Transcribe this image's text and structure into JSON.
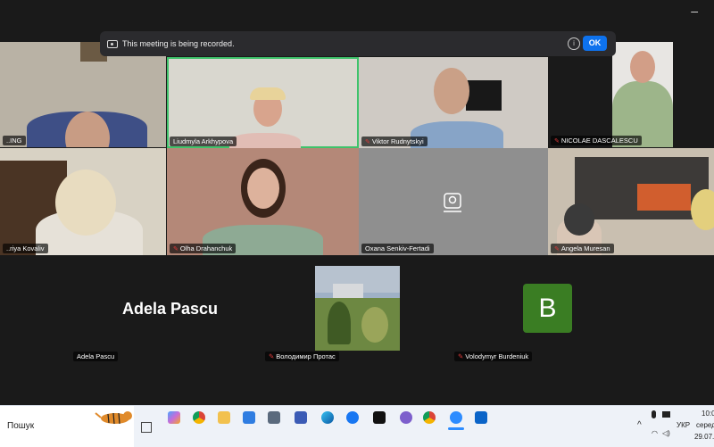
{
  "recording_banner": {
    "text": "This meeting is being recorded.",
    "ok_label": "OK",
    "info": "i"
  },
  "participants": {
    "p1": "..ING",
    "p2": "Liudmyla Arkhypova",
    "p3": "Viktor Rudnytskyi",
    "p4": "NICOLAE DASCALESCU",
    "p5": "..riya Kovaliv",
    "p6": "Olha Drahanchuk",
    "p7": "Oxana Senkiv-Fertadi",
    "p8": "Angela Muresan",
    "p9": "Adela Pascu",
    "p9_big": "Adela Pascu",
    "p10": "Володимир Протас",
    "p11": "Volodymyr Burdeniuk",
    "p11_avatar": "B"
  },
  "taskbar": {
    "search_label": "Пошук",
    "lang": "УКР",
    "time": "10:0",
    "date": "29.07.2",
    "day": "серед",
    "icons": [
      "copilot-icon",
      "chrome-icon",
      "file-explorer-icon",
      "calculator-icon",
      "calendar-icon",
      "save-icon",
      "edge-icon",
      "facebook-icon",
      "capcut-icon",
      "viber-icon",
      "chrome2-icon",
      "zoom-icon",
      "outlook-icon"
    ]
  },
  "colors": {
    "accent": "#0e72ed",
    "active_speaker": "#3fc36b",
    "avatar_bg": "#3a7d23",
    "muted": "#e03a3a"
  }
}
